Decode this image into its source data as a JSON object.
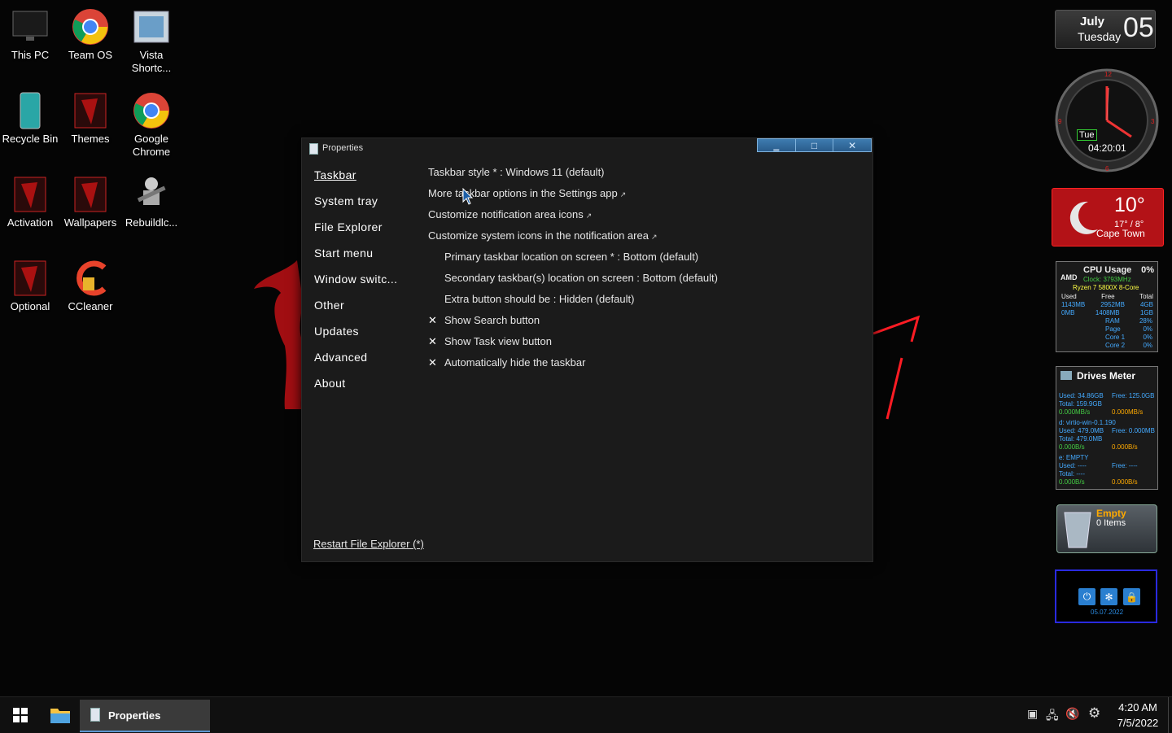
{
  "desktop": {
    "icons": [
      {
        "label": "This PC"
      },
      {
        "label": "Team OS"
      },
      {
        "label": "Vista Shortc..."
      },
      {
        "label": "Recycle Bin"
      },
      {
        "label": "Themes"
      },
      {
        "label": "Google Chrome"
      },
      {
        "label": "Activation"
      },
      {
        "label": "Wallpapers"
      },
      {
        "label": "Rebuildlc..."
      },
      {
        "label": "Optional"
      },
      {
        "label": "CCleaner"
      }
    ]
  },
  "window": {
    "title": "Properties",
    "buttons": {
      "minimize": "‗",
      "maximize": "□",
      "close": "✕"
    },
    "nav": [
      {
        "label": "Taskbar"
      },
      {
        "label": "System tray"
      },
      {
        "label": "File Explorer"
      },
      {
        "label": "Start menu"
      },
      {
        "label": "Window switc..."
      },
      {
        "label": "Other"
      },
      {
        "label": "Updates"
      },
      {
        "label": "Advanced"
      },
      {
        "label": "About"
      }
    ],
    "options": [
      {
        "label": "Taskbar style * : Windows 11 (default)"
      },
      {
        "label": "More taskbar options in the Settings app",
        "ext": "↗"
      },
      {
        "label": "Customize notification area icons",
        "ext": "↗"
      },
      {
        "label": "Customize system icons in the notification area",
        "ext": "↗"
      },
      {
        "label": "Primary taskbar location on screen * : Bottom (default)"
      },
      {
        "label": "Secondary taskbar(s) location on screen : Bottom (default)"
      },
      {
        "label": "Extra button should be : Hidden (default)"
      },
      {
        "label": "Show Search button",
        "mark": "✕"
      },
      {
        "label": "Show Task view button",
        "mark": "✕"
      },
      {
        "label": "Automatically hide the taskbar",
        "mark": "✕"
      }
    ],
    "restart_label": "Restart File Explorer (*)"
  },
  "widgets": {
    "date": {
      "month": "July",
      "weekday": "Tuesday",
      "day": "05"
    },
    "clock": {
      "day": "Tue",
      "time": "04:20:01"
    },
    "weather": {
      "temp": "10°",
      "range": "17° / 8°",
      "city": "Cape Town"
    },
    "cpu": {
      "title": "CPU Usage",
      "percent": "0%",
      "brand": "AMD",
      "clock": "Clock: 3793MHz",
      "model": "Ryzen 7 5800X 8-Core",
      "head": [
        "Used",
        "Free",
        "Total"
      ],
      "row1": [
        "1143MB",
        "2952MB",
        "4GB"
      ],
      "row2": [
        "0MB",
        "1408MB",
        "1GB"
      ],
      "rows": [
        [
          "RAM",
          "28%"
        ],
        [
          "Page",
          "0%"
        ],
        [
          "Core 1",
          "0%"
        ],
        [
          "Core 2",
          "0%"
        ]
      ]
    },
    "drives": {
      "title": "Drives Meter",
      "c_used": "Used: 34.86GB",
      "c_free": "Free: 125.0GB",
      "c_total": "Total: 159.9GB",
      "c_up": "0.000MB/s",
      "c_down": "0.000MB/s",
      "d_name": "d: virtio-win-0.1.190",
      "d_used": "Used: 479.0MB",
      "d_free": "Free: 0.000MB",
      "d_total": "Total: 479.0MB",
      "d_up": "0.000B/s",
      "d_down": "0.000B/s",
      "e_name": "e: EMPTY",
      "e_used": "Used: ----",
      "e_free": "Free: ----",
      "e_total": "Total: ----",
      "e_up": "0.000B/s",
      "e_down": "0.000B/s"
    },
    "bin": {
      "status": "Empty",
      "items": "0 Items"
    },
    "lock": {
      "date": "05.07.2022"
    }
  },
  "taskbar": {
    "app_label": "Properties",
    "time": "4:20 AM",
    "date": "7/5/2022"
  },
  "colors": {
    "accent": "#5c96d0",
    "window_bg": "#1b1b1b",
    "weather_red": "#b31217"
  }
}
